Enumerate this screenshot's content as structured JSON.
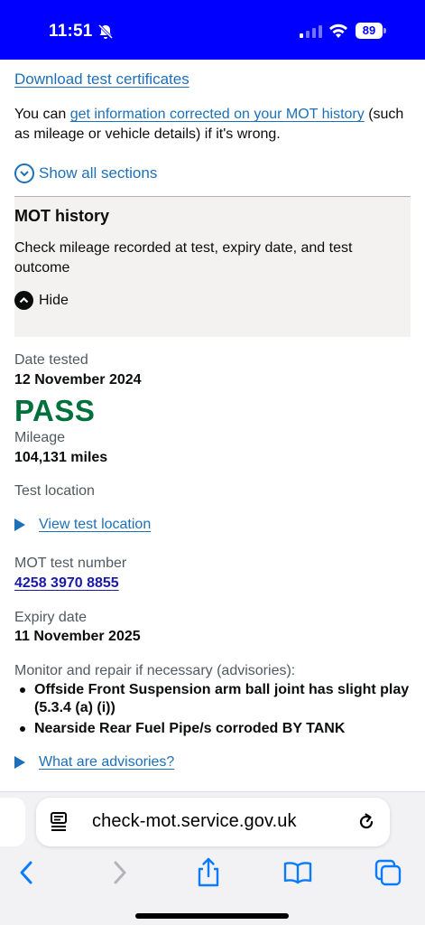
{
  "status_bar": {
    "time": "11:51",
    "battery": "89",
    "bell_icon": "bell-slash-icon",
    "signal_icon": "cellular-signal-icon",
    "wifi_icon": "wifi-icon"
  },
  "page": {
    "download_link": "Download test certificates",
    "correct_prefix": "You can ",
    "correct_link": "get information corrected on your MOT history",
    "correct_suffix": " (such as mileage or vehicle details) if it's wrong.",
    "show_all_sections": "Show all sections",
    "accordion": {
      "title": "MOT history",
      "summary": "Check mileage recorded at test, expiry date, and test outcome",
      "toggle_label": "Hide"
    },
    "test": {
      "date_label": "Date tested",
      "date_value": "12 November 2024",
      "result": "PASS",
      "mileage_label": "Mileage",
      "mileage_value": "104,131 miles",
      "location_label": "Test location",
      "location_link": "View test location",
      "number_label": "MOT test number",
      "number_value": "4258 3970 8855",
      "expiry_label": "Expiry date",
      "expiry_value": "11 November 2025",
      "advisories_label": "Monitor and repair if necessary (advisories):",
      "advisories": [
        "Offside Front Suspension arm ball joint has slight play (5.3.4 (a) (i))",
        "Nearside Rear Fuel Pipe/s corroded BY TANK"
      ],
      "advisories_help": "What are advisories?"
    }
  },
  "browser": {
    "url": "check-mot.service.gov.uk",
    "toolbar_icons": [
      "back-icon",
      "forward-icon",
      "share-icon",
      "bookmarks-icon",
      "tabs-icon"
    ]
  },
  "colors": {
    "status_bar_bg": "#0000ff",
    "link": "#1d70b8",
    "pass_green": "#00703c",
    "accordion_bg": "#f3f2f1"
  }
}
